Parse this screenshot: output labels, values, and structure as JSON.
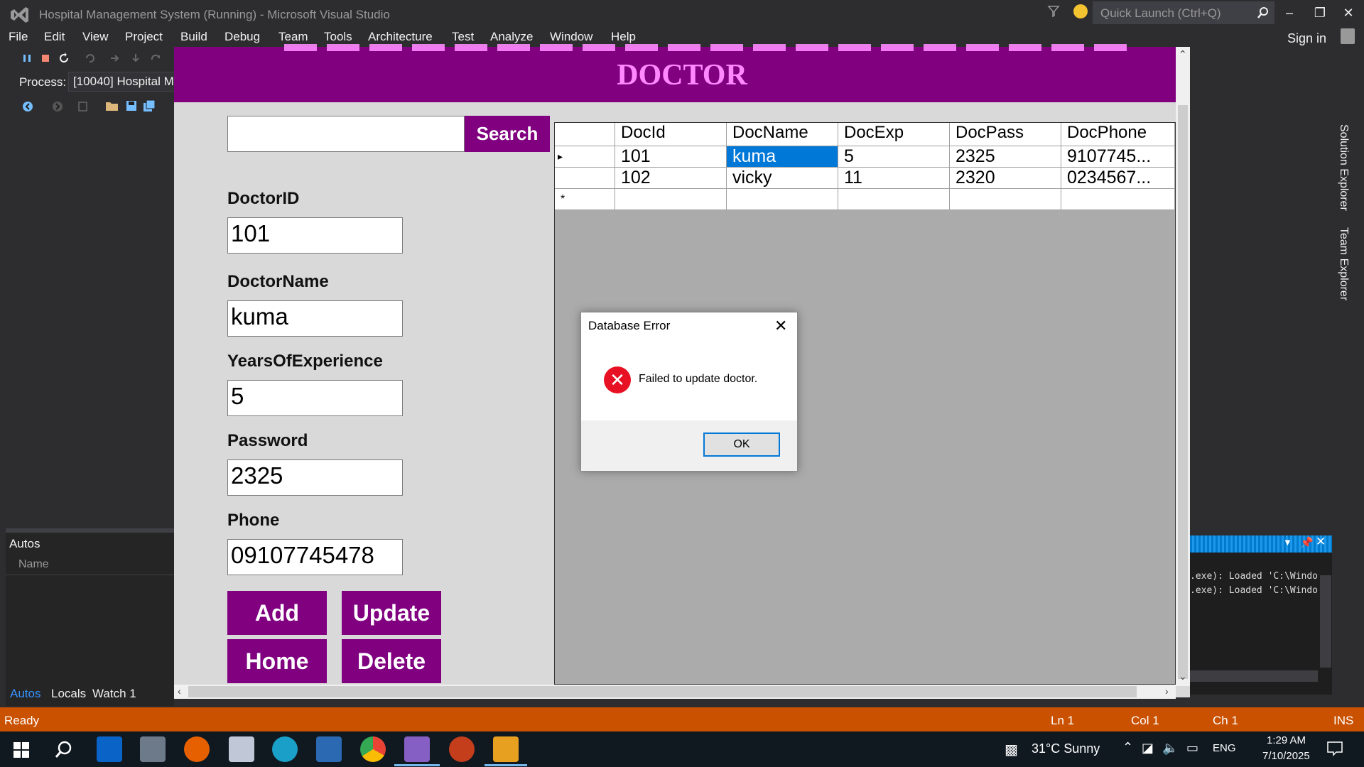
{
  "window": {
    "title": "Hospital Management System (Running) - Microsoft Visual Studio",
    "quick_launch_placeholder": "Quick Launch (Ctrl+Q)",
    "sign_in": "Sign in"
  },
  "menu": [
    "File",
    "Edit",
    "View",
    "Project",
    "Build",
    "Debug",
    "Team",
    "Tools",
    "Architecture",
    "Test",
    "Analyze",
    "Window",
    "Help"
  ],
  "debug_toolbar": {
    "process_label": "Process:",
    "process_value": "[10040] Hospital M"
  },
  "autos": {
    "title": "Autos",
    "column_name": "Name",
    "tabs": [
      "Autos",
      "Locals",
      "Watch 1"
    ]
  },
  "right_tabs": [
    "Solution Explorer",
    "Team Explorer"
  ],
  "output": {
    "lines": [
      ".exe): Loaded 'C:\\Windo",
      ".exe): Loaded 'C:\\Windo"
    ]
  },
  "app": {
    "header_title": "DOCTOR",
    "search_button": "Search",
    "search_value": "",
    "fields": [
      {
        "label": "DoctorID",
        "value": "101"
      },
      {
        "label": "DoctorName",
        "value": "kuma"
      },
      {
        "label": "YearsOfExperience",
        "value": "5"
      },
      {
        "label": "Password",
        "value": "2325"
      },
      {
        "label": "Phone",
        "value": "09107745478"
      }
    ],
    "buttons": {
      "add": "Add",
      "update": "Update",
      "home": "Home",
      "delete": "Delete"
    },
    "grid": {
      "columns": [
        "DocId",
        "DocName",
        "DocExp",
        "DocPass",
        "DocPhone"
      ],
      "rows": [
        [
          "101",
          "kuma",
          "5",
          "2325",
          "9107745..."
        ],
        [
          "102",
          "vicky",
          "11",
          "2320",
          "0234567..."
        ]
      ],
      "new_row_marker": "*",
      "current_row_marker": "▸"
    }
  },
  "dialog": {
    "title": "Database Error",
    "message": "Failed to update doctor.",
    "ok": "OK"
  },
  "statusbar": {
    "ready": "Ready",
    "ln": "Ln 1",
    "col": "Col 1",
    "ch": "Ch 1",
    "ins": "INS"
  },
  "taskbar": {
    "weather": "31°C  Sunny",
    "language": "ENG",
    "time": "1:29 AM",
    "date": "7/10/2025"
  },
  "colors": {
    "accent_purple": "#800080",
    "status_orange": "#ca5100",
    "selection_blue": "#0078d7"
  }
}
